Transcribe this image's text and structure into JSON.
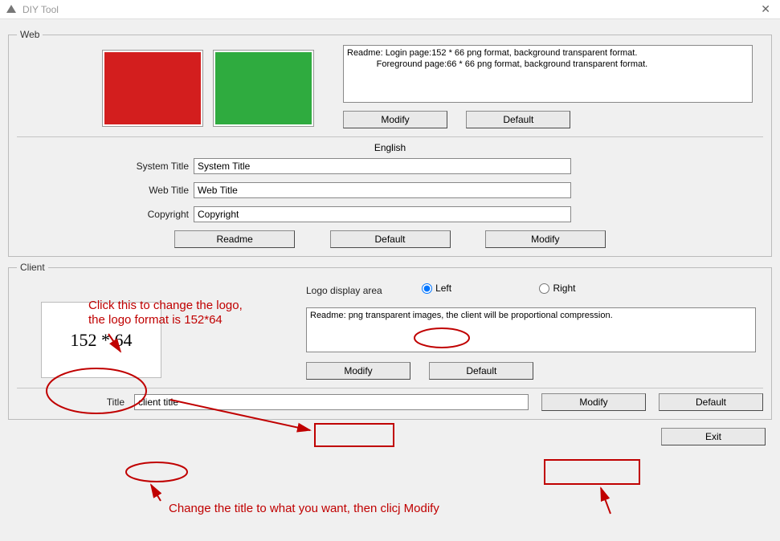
{
  "window": {
    "title": "DIY Tool"
  },
  "web": {
    "legend": "Web",
    "swatches": {
      "red": "#d31e1e",
      "green": "#2fab3f"
    },
    "readme_line1": "Readme: Login page:152 * 66 png format, background transparent format.",
    "readme_line2": "            Foreground page:66 * 66 png format, background transparent format.",
    "btn_modify": "Modify",
    "btn_default": "Default",
    "lang_header": "English",
    "labels": {
      "system_title": "System Title",
      "web_title": "Web Title",
      "copyright": "Copyright"
    },
    "values": {
      "system_title": "System Title",
      "web_title": "Web Title",
      "copyright": "Copyright"
    },
    "bottom": {
      "readme": "Readme",
      "default": "Default",
      "modify": "Modify"
    }
  },
  "client": {
    "legend": "Client",
    "logo_area_label": "Logo display area",
    "radio_left": "Left",
    "radio_right": "Right",
    "logo_text": "152 * 64",
    "readme": "Readme: png transparent images, the client will be proportional compression.",
    "btn_modify": "Modify",
    "btn_default": "Default",
    "title_label": "Title",
    "title_value": "client title",
    "title_modify": "Modify",
    "title_default": "Default"
  },
  "footer": {
    "exit": "Exit"
  },
  "annotations": {
    "a1": "Click this to change the logo,\nthe logo format is 152*64",
    "a2": "Change the title to what you want, then clicj Modify"
  }
}
